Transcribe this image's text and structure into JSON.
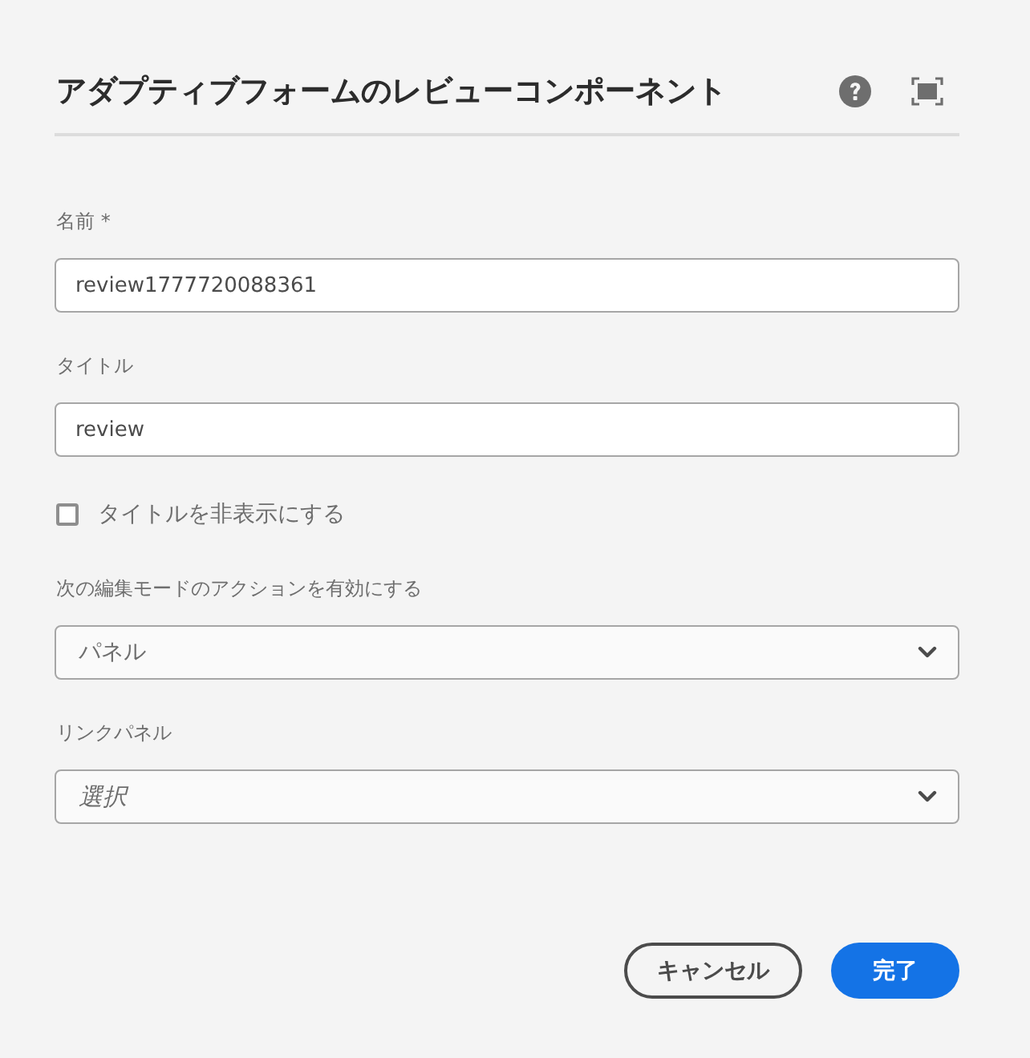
{
  "dialog": {
    "title": "アダプティブフォームのレビューコンポーネント",
    "fields": [
      {
        "kind": "text",
        "label": "名前 *",
        "value": "review1777720088361"
      },
      {
        "kind": "text",
        "label": "タイトル",
        "value": "review"
      },
      {
        "kind": "checkbox",
        "label": "タイトルを非表示にする",
        "checked": false
      },
      {
        "kind": "select",
        "label": "次の編集モードのアクションを有効にする",
        "value": "パネル"
      },
      {
        "kind": "select",
        "label": "リンクパネル",
        "placeholder": "選択"
      }
    ],
    "buttons": [
      {
        "kind": "secondary",
        "label": "キャンセル"
      },
      {
        "kind": "primary",
        "label": "完了"
      }
    ]
  }
}
